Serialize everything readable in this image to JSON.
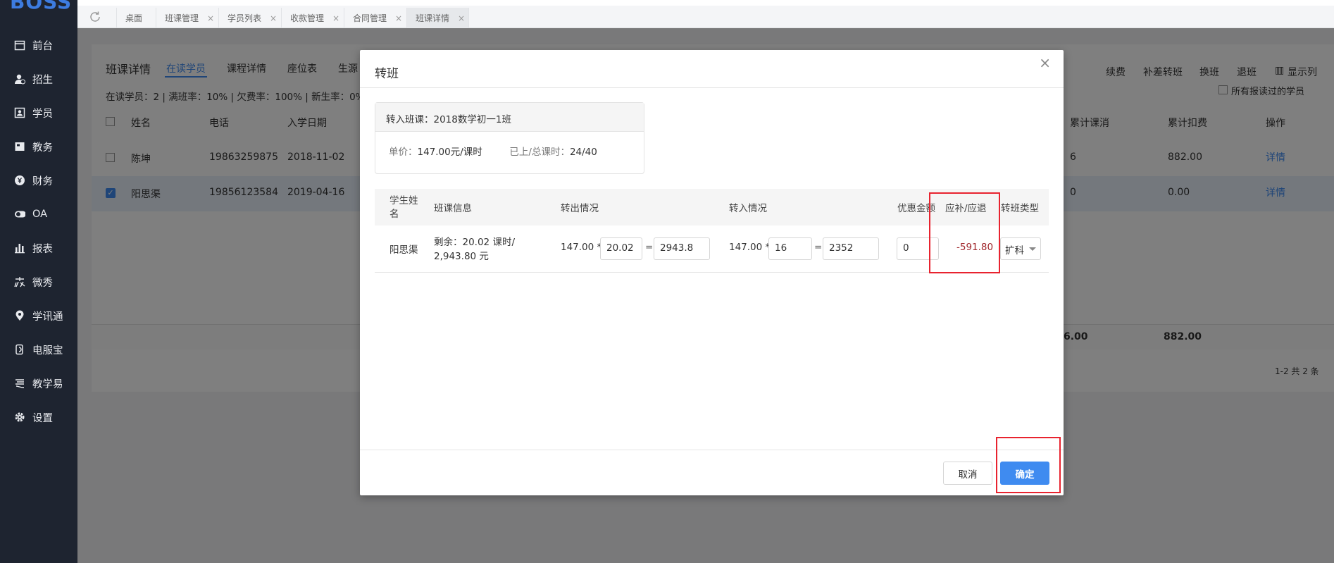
{
  "app": {
    "logo": "BOSS"
  },
  "sidebar": {
    "items": [
      {
        "label": "前台",
        "icon": "calendar-icon"
      },
      {
        "label": "招生",
        "icon": "user-plus-icon"
      },
      {
        "label": "学员",
        "icon": "id-card-icon"
      },
      {
        "label": "教务",
        "icon": "book-icon"
      },
      {
        "label": "财务",
        "icon": "yen-icon"
      },
      {
        "label": "OA",
        "icon": "toggle-icon"
      },
      {
        "label": "报表",
        "icon": "bar-chart-icon"
      },
      {
        "label": "微秀",
        "icon": "wei-icon"
      },
      {
        "label": "学讯通",
        "icon": "location-icon"
      },
      {
        "label": "电服宝",
        "icon": "phone-icon"
      },
      {
        "label": "教学易",
        "icon": "teach-icon"
      },
      {
        "label": "设置",
        "icon": "gear-icon"
      }
    ]
  },
  "tabs": [
    {
      "label": "桌面",
      "closable": false
    },
    {
      "label": "班课管理",
      "closable": true
    },
    {
      "label": "学员列表",
      "closable": true
    },
    {
      "label": "收款管理",
      "closable": true
    },
    {
      "label": "合同管理",
      "closable": true
    },
    {
      "label": "班课详情",
      "closable": true,
      "active": true
    }
  ],
  "background": {
    "page_title": "班课详情",
    "subtabs": [
      "在读学员",
      "课程详情",
      "座位表",
      "生源"
    ],
    "actions": [
      "续费",
      "补差转班",
      "换班",
      "退班",
      "显示列"
    ],
    "show_all_label": "所有报读过的学员",
    "stats": "在读学员：2 | 满班率：10% | 欠费率：100% | 新生率：0%",
    "columns": [
      "姓名",
      "电话",
      "入学日期",
      "累计课消",
      "累计扣费",
      "操作"
    ],
    "rows": [
      {
        "name": "陈坤",
        "phone": "19863259875",
        "date": "2018-11-02",
        "consumed": "6",
        "deducted": "882.00",
        "action": "详情",
        "checked": false
      },
      {
        "name": "阳思渠",
        "phone": "19856123584",
        "date": "2019-04-16",
        "consumed": "0",
        "deducted": "0.00",
        "action": "详情",
        "checked": true
      }
    ],
    "totals": {
      "consumed": "6.00",
      "deducted": "882.00"
    },
    "pagination": "1-2  共 2 条"
  },
  "modal": {
    "title": "转班",
    "close_symbol": "×",
    "target_class_label": "转入班课：",
    "target_class": "2018数学初一1班",
    "unit_price_label": "单价：",
    "unit_price": "147.00元/课时",
    "lessons_label": "已上/总课时：",
    "lessons": "24/40",
    "table": {
      "headers": {
        "student": "学生姓名",
        "class_info": "班课信息",
        "out": "转出情况",
        "in": "转入情况",
        "discount": "优惠金额",
        "balance": "应补/应退",
        "type": "转班类型"
      },
      "row": {
        "student": "阳思渠",
        "class_info_line1": "剩余：20.02 课时/",
        "class_info_line2": "2,943.80 元",
        "out_price": "147.00 *",
        "out_qty": "20.02",
        "out_eq": "=",
        "out_total": "2943.8",
        "in_price": "147.00 *",
        "in_qty": "16",
        "in_eq": "=",
        "in_total": "2352",
        "discount": "0",
        "balance": "-591.80",
        "type": "扩科"
      }
    },
    "cancel_label": "取消",
    "ok_label": "确定"
  },
  "colors": {
    "accent": "#3f8bf0",
    "highlight_box": "#e8232f",
    "negative": "#a0262b",
    "sidebar": "#1e2430"
  }
}
